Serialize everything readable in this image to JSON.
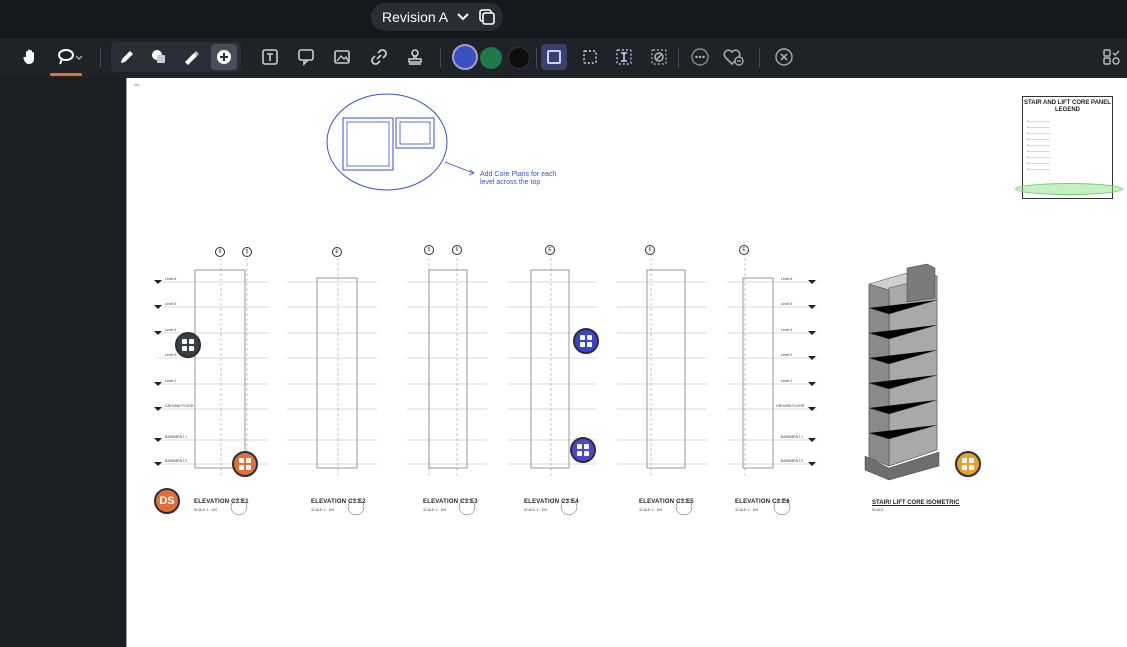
{
  "topbar": {
    "revision_label": "Revision A",
    "dropdown_icon": "chevron-down-icon",
    "compare_icon": "compare-icon"
  },
  "toolbar": {
    "tools": [
      "pan-hand-icon",
      "lasso-select-icon",
      "pen-icon",
      "shape-fill-icon",
      "highlighter-icon",
      "add-icon",
      "text-box-icon",
      "callout-icon",
      "image-icon",
      "link-icon",
      "stamp-icon"
    ],
    "colors": {
      "selected": "#3b4fc4",
      "green": "#1e7a4a",
      "black": "#111111"
    },
    "line_styles": [
      "solid-box-icon",
      "dashed-box-icon",
      "text-cursor-icon",
      "no-fill-icon"
    ],
    "extra": [
      "more-icon",
      "favorite-icon",
      "close-icon",
      "layers-settings-icon"
    ],
    "accent": "#e0703a"
  },
  "drawing": {
    "corner_tag": "A0a",
    "markup_note": "Add Core Plans for each level across the top",
    "legend": {
      "title": "STAIR AND LIFT CORE PANEL LEGEND"
    },
    "elevations": [
      {
        "label": "ELEVATION",
        "ref": "C3.E1",
        "scale": "SCALE 1 : 100"
      },
      {
        "label": "ELEVATION",
        "ref": "C3.E2",
        "scale": "SCALE 1 : 100"
      },
      {
        "label": "ELEVATION",
        "ref": "C3.E3",
        "scale": "SCALE 1 : 100"
      },
      {
        "label": "ELEVATION",
        "ref": "C3.E4",
        "scale": "SCALE 1 : 100"
      },
      {
        "label": "ELEVATION",
        "ref": "C3.E5",
        "scale": "SCALE 1 : 100"
      },
      {
        "label": "ELEVATION",
        "ref": "C3.E6",
        "scale": "SCALE 1 : 100"
      }
    ],
    "isometric_label": "STAIR/ LIFT CORE ISOMETRIC",
    "isometric_scale": "SCALE",
    "levels_left": [
      "Level 6",
      "Level 5",
      "Level 4",
      "Level 3",
      "Level 1",
      "GROUND FLOOR",
      "BASEMENT 1",
      "BASEMENT 2"
    ],
    "levels_right": [
      "Level 6",
      "Level 5",
      "Level 4",
      "Level 2",
      "Level 1",
      "GROUND FLOOR",
      "BASEMENT 1",
      "BASEMENT 2"
    ],
    "grid_marks": [
      "6",
      "5",
      "E",
      "5",
      "6",
      "E",
      "6",
      "E"
    ]
  },
  "markers": {
    "ds_initials": "DS"
  }
}
